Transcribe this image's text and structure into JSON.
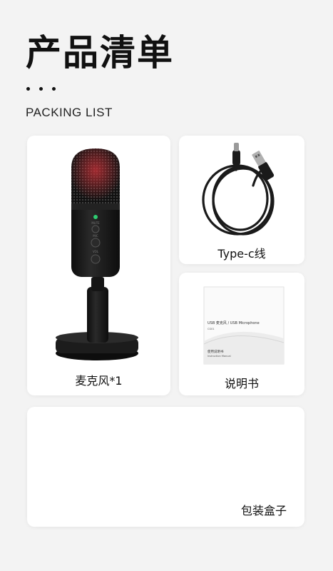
{
  "header": {
    "title": "产品清单",
    "subtitle": "PACKING LIST"
  },
  "items": [
    {
      "label": "麦克风*1",
      "icon": "microphone-icon"
    },
    {
      "label": "Type-c线",
      "icon": "usb-c-cable-icon"
    },
    {
      "label": "说明书",
      "icon": "instruction-manual-icon"
    },
    {
      "label": "包装盒子",
      "icon": "packaging-box"
    }
  ],
  "manual": {
    "cover_title": "USB 麦克风 / USB Microphone",
    "model": "CG01",
    "subtitle": "使用说明书",
    "subtitle_en": "Instruction Manual"
  },
  "mic_buttons": {
    "mute": "MUTE",
    "mic": "MIC",
    "vol": "VOL"
  },
  "colors": {
    "background": "#f3f3f3",
    "card": "#ffffff",
    "text": "#111111",
    "mic_body": "#1a1a1a",
    "indicator": "#2ecc71"
  }
}
